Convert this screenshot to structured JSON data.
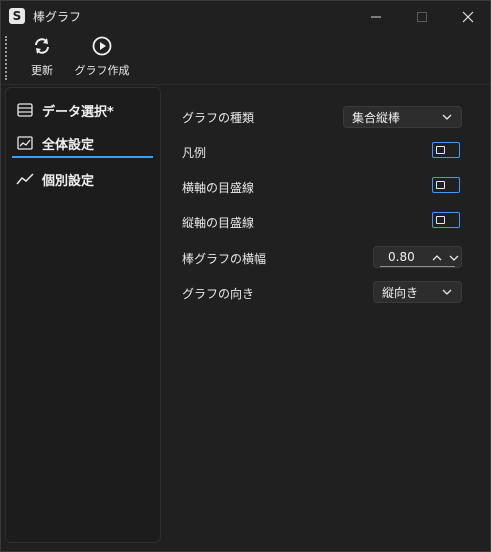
{
  "window": {
    "app_icon_letter": "S",
    "title": "棒グラフ"
  },
  "toolbar": {
    "refresh_label": "更新",
    "create_label": "グラフ作成"
  },
  "sidebar": {
    "items": [
      {
        "label": "データ選択*",
        "icon": "table-icon"
      },
      {
        "label": "全体設定",
        "icon": "chart-line-icon",
        "selected": true
      },
      {
        "label": "個別設定",
        "icon": "trend-icon"
      }
    ],
    "accent_color": "#3a9bff"
  },
  "settings": {
    "chart_type": {
      "label": "グラフの種類",
      "value": "集合縦棒"
    },
    "legend": {
      "label": "凡例",
      "on": false
    },
    "x_grid": {
      "label": "横軸の目盛線",
      "on": false
    },
    "y_grid": {
      "label": "縦軸の目盛線",
      "on": false
    },
    "bar_width": {
      "label": "棒グラフの横幅",
      "value": "0.80"
    },
    "orientation": {
      "label": "グラフの向き",
      "value": "縦向き"
    }
  }
}
